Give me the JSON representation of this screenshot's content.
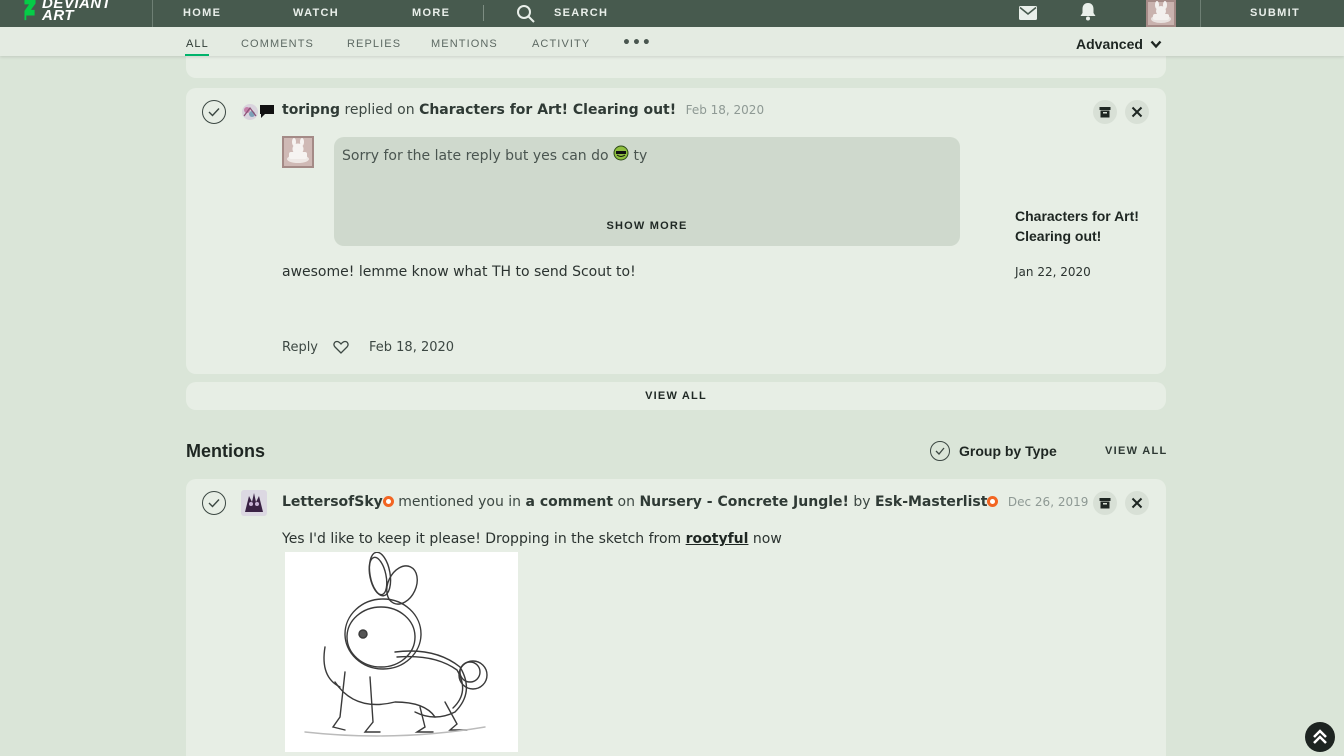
{
  "nav": {
    "logo_line1": "DEVIANT",
    "logo_line2": "ART",
    "home": "HOME",
    "watch": "WATCH",
    "more": "MORE",
    "search": "SEARCH",
    "submit": "SUBMIT"
  },
  "tabs": {
    "all": "ALL",
    "comments": "COMMENTS",
    "replies": "REPLIES",
    "mentions": "MENTIONS",
    "activity": "ACTIVITY",
    "more": "•••",
    "advanced": "Advanced"
  },
  "reply_card": {
    "username": "toripng",
    "action": "replied on",
    "target": "Characters for Art! Clearing out!",
    "date": "Feb 18, 2020",
    "quoted_text": "Sorry for the late reply but yes can do",
    "quoted_suffix": "ty",
    "show_more": "SHOW MORE",
    "reply_text": "awesome! lemme know what TH to send Scout to!",
    "reply_label": "Reply",
    "footer_date": "Feb 18, 2020",
    "deviation_title": "Characters for Art! Clearing out!",
    "deviation_date": "Jan 22, 2020"
  },
  "view_all_bar": "VIEW ALL",
  "mentions": {
    "title": "Mentions",
    "group_by": "Group by Type",
    "view_all": "VIEW ALL",
    "card": {
      "username": "LettersofSky",
      "action_pre": "mentioned you in",
      "action_link": "a comment",
      "action_on": "on",
      "target": "Nursery - Concrete Jungle!",
      "by": "by",
      "target_author": "Esk-Masterlist",
      "date": "Dec 26, 2019",
      "body_pre": "Yes I'd like to keep it please! Dropping in the sketch from",
      "body_link": "rootyful",
      "body_post": "now"
    }
  },
  "colors": {
    "topbar": "#475a4e",
    "background": "#dae5d8",
    "card": "#e7eee5",
    "accent_green": "#00b36b",
    "badge_orange": "#f26522"
  }
}
